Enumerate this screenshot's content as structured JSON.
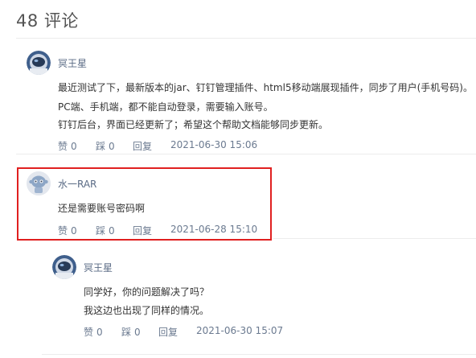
{
  "section": {
    "heading": "48 评论"
  },
  "comments": [
    {
      "author": "冥王星",
      "avatar": "astronaut-avatar",
      "lines": [
        "最近测试了下，最新版本的jar、钉钉管理插件、html5移动端展现插件，同步了用户(手机号码)。",
        "PC端、手机端，都不能自动登录，需要输入账号。",
        "钉钉后台，界面已经更新了；希望这个帮助文档能够同步更新。"
      ],
      "like_label": "赞",
      "like_count": "0",
      "dislike_label": "踩",
      "dislike_count": "0",
      "reply_label": "回复",
      "time": "2021-06-30 15:06"
    },
    {
      "author": "水一RAR",
      "avatar": "robot-avatar",
      "lines": [
        "还是需要账号密码啊"
      ],
      "like_label": "赞",
      "like_count": "0",
      "dislike_label": "踩",
      "dislike_count": "0",
      "reply_label": "回复",
      "time": "2021-06-28 15:10"
    },
    {
      "author": "冥王星",
      "avatar": "astronaut-avatar",
      "lines": [
        "同学好，你的问题解决了吗？",
        "我这边也出现了同样的情况。"
      ],
      "like_label": "赞",
      "like_count": "0",
      "dislike_label": "踩",
      "dislike_count": "0",
      "reply_label": "回复",
      "time": "2021-06-30 15:07"
    }
  ],
  "colors": {
    "highlight": "#e02020",
    "author": "#5a6b85",
    "meta": "#6b7a90"
  }
}
